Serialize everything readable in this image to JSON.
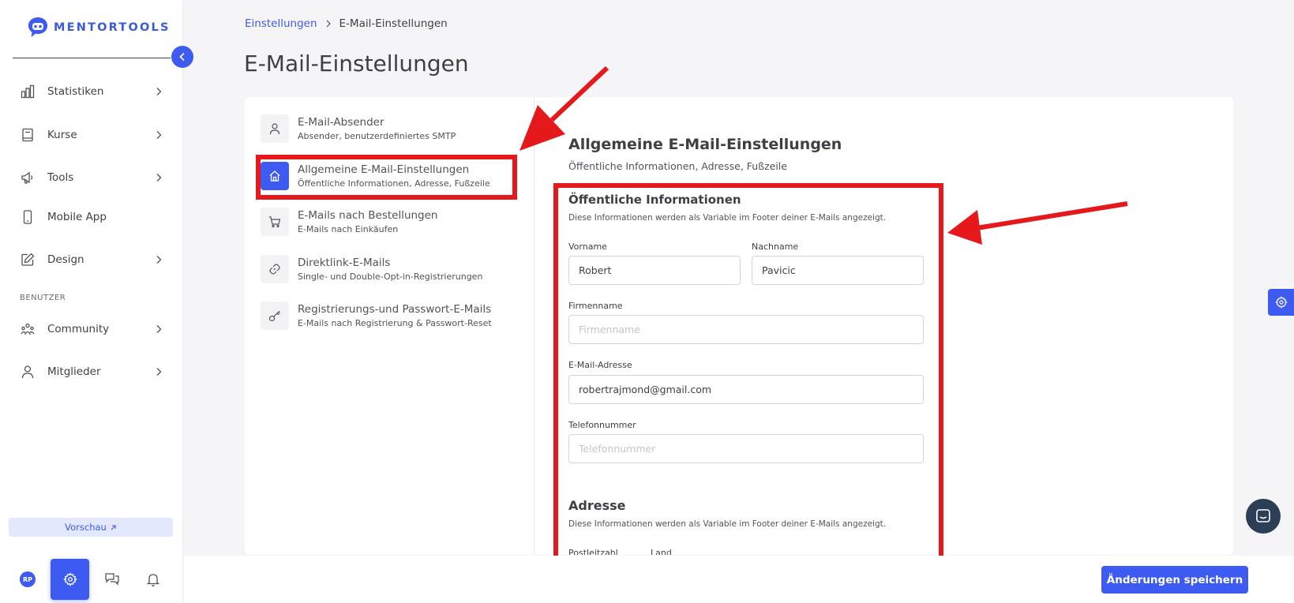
{
  "brand": {
    "name": "MENTORTOOLS",
    "accent": "#3d5af1",
    "annotation_color": "#e5191b"
  },
  "sidebar": {
    "items": [
      {
        "label": "Statistiken",
        "icon": "bar-chart-icon",
        "has_chevron": true
      },
      {
        "label": "Kurse",
        "icon": "book-icon",
        "has_chevron": true
      },
      {
        "label": "Tools",
        "icon": "megaphone-icon",
        "has_chevron": true
      },
      {
        "label": "Mobile App",
        "icon": "smartphone-icon",
        "has_chevron": false
      },
      {
        "label": "Design",
        "icon": "pencil-icon",
        "has_chevron": true
      }
    ],
    "section_label": "BENUTZER",
    "user_items": [
      {
        "label": "Community",
        "icon": "community-icon",
        "has_chevron": true
      },
      {
        "label": "Mitglieder",
        "icon": "user-icon",
        "has_chevron": true
      }
    ],
    "preview_label": "Vorschau",
    "avatar_initials": "RP"
  },
  "breadcrumb": {
    "parent": "Einstellungen",
    "current": "E-Mail-Einstellungen"
  },
  "page_title": "E-Mail-Einstellungen",
  "settings_menu": [
    {
      "title": "E-Mail-Absender",
      "subtitle": "Absender, benutzerdefiniertes SMTP",
      "icon": "user-icon",
      "active": false
    },
    {
      "title": "Allgemeine E-Mail-Einstellungen",
      "subtitle": "Öffentliche Informationen, Adresse, Fußzeile",
      "icon": "home-icon",
      "active": true
    },
    {
      "title": "E-Mails nach Bestellungen",
      "subtitle": "E-Mails nach Einkäufen",
      "icon": "cart-icon",
      "active": false
    },
    {
      "title": "Direktlink-E-Mails",
      "subtitle": "Single- und Double-Opt-in-Registrierungen",
      "icon": "link-icon",
      "active": false
    },
    {
      "title": "Registrierungs-und Passwort-E-Mails",
      "subtitle": "E-Mails nach Registrierung & Passwort-Reset",
      "icon": "key-icon",
      "active": false
    }
  ],
  "section": {
    "title": "Allgemeine E-Mail-Einstellungen",
    "subtitle": "Öffentliche Informationen, Adresse, Fußzeile"
  },
  "public_info": {
    "title": "Öffentliche Informationen",
    "subtitle": "Diese Informationen werden als Variable im Footer deiner E-Mails angezeigt.",
    "fields": {
      "vorname": {
        "label": "Vorname",
        "value": "Robert",
        "placeholder": ""
      },
      "nachname": {
        "label": "Nachname",
        "value": "Pavicic",
        "placeholder": ""
      },
      "firmenname": {
        "label": "Firmenname",
        "value": "",
        "placeholder": "Firmenname"
      },
      "email": {
        "label": "E-Mail-Adresse",
        "value": "robertrajmond@gmail.com",
        "placeholder": ""
      },
      "telefon": {
        "label": "Telefonnummer",
        "value": "",
        "placeholder": "Telefonnummer"
      }
    }
  },
  "address": {
    "title": "Adresse",
    "subtitle": "Diese Informationen werden als Variable im Footer deiner E-Mails angezeigt.",
    "postleitzahl_label": "Postleitzahl",
    "land_label": "Land"
  },
  "save_label": "Änderungen speichern"
}
